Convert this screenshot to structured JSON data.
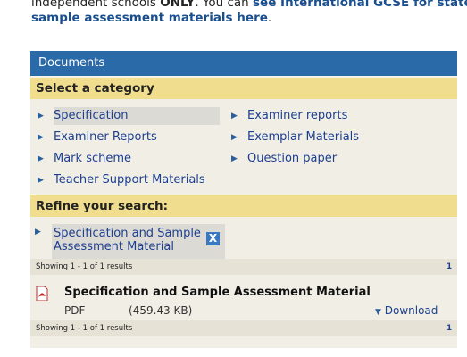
{
  "intro": {
    "line1_pre": "independent schools ",
    "line1_strong": "ONLY",
    "line1_mid": ". You can ",
    "line1_link": "see International GCSE for state s",
    "line2_link": "sample assessment materials here",
    "line2_post": "."
  },
  "panel": {
    "header": "Documents",
    "category_heading": "Select a category",
    "categories_left": [
      "Specification",
      "Examiner Reports",
      "Mark scheme",
      "Teacher Support Materials"
    ],
    "categories_right": [
      "Examiner reports",
      "Exemplar Materials",
      "Question paper"
    ],
    "refine_heading": "Refine your search:",
    "refine_filter_line1": "Specification and Sample",
    "refine_filter_line2": "Assessment Material",
    "remove_filter_label": "X",
    "results_text": "Showing 1 - 1 of 1 results",
    "page_number": "1"
  },
  "document": {
    "title": "Specification and Sample Assessment Material",
    "type": "PDF",
    "size": "(459.43 KB)",
    "download_label": "Download",
    "icon": "pdf-icon"
  },
  "colors": {
    "header_bg": "#2a6aa8",
    "section_bg": "#f0de8e",
    "panel_bg": "#f1eee6",
    "link": "#1c3f8f"
  }
}
